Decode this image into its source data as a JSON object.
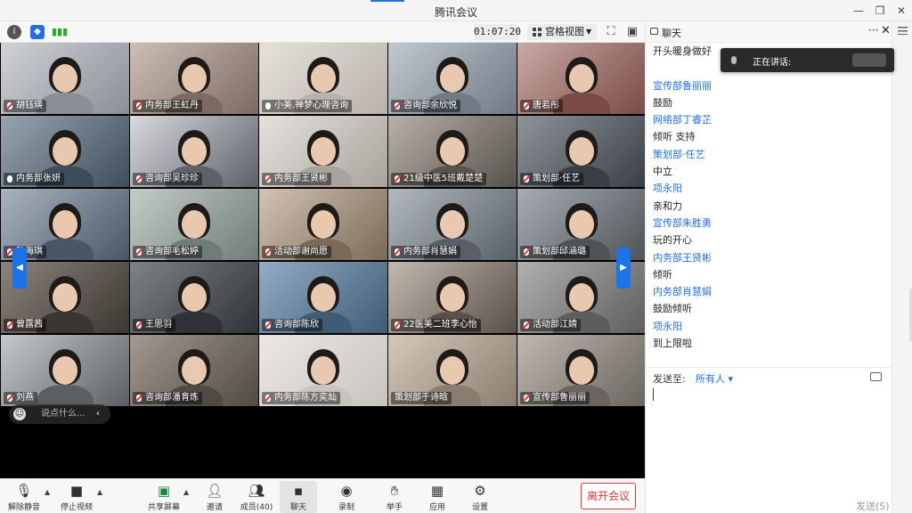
{
  "window": {
    "title": "腾讯会议"
  },
  "top_toolbar": {
    "timer": "01:07:20",
    "view_label": "宫格视图"
  },
  "participants": [
    {
      "name": "胡钰瑛",
      "mic": "muted"
    },
    {
      "name": "内务部王虹丹",
      "mic": "muted"
    },
    {
      "name": "小美.禅梦心理咨询",
      "mic": "on"
    },
    {
      "name": "咨询部余欣悦",
      "mic": "muted"
    },
    {
      "name": "唐若彤",
      "mic": "muted"
    },
    {
      "name": "内务部张妍",
      "mic": "on"
    },
    {
      "name": "咨询部吴珍珍",
      "mic": "muted"
    },
    {
      "name": "内务部王贤彬",
      "mic": "muted"
    },
    {
      "name": "21级中医5班戴楚楚",
      "mic": "muted"
    },
    {
      "name": "策划部·任艺",
      "mic": "muted"
    },
    {
      "name": "孙海琪",
      "mic": "muted"
    },
    {
      "name": "咨询部毛松婷",
      "mic": "muted"
    },
    {
      "name": "活动部谢尚愿",
      "mic": "muted"
    },
    {
      "name": "内务部肖慧娟",
      "mic": "muted"
    },
    {
      "name": "策划部邱涵璐",
      "mic": "muted"
    },
    {
      "name": "曾露茜",
      "mic": "muted"
    },
    {
      "name": "王思羽",
      "mic": "muted"
    },
    {
      "name": "咨询部陈欣",
      "mic": "muted"
    },
    {
      "name": "22医美二班李心怡",
      "mic": "muted"
    },
    {
      "name": "活动部江婧",
      "mic": "muted"
    },
    {
      "name": "刘燕",
      "mic": "muted"
    },
    {
      "name": "咨询部潘育炼",
      "mic": "muted"
    },
    {
      "name": "内务部陈方奕灿",
      "mic": "muted"
    },
    {
      "name": "策划部于诗晗",
      "mic": "none"
    },
    {
      "name": "宣传部鲁丽丽",
      "mic": "muted"
    }
  ],
  "quick_chat": {
    "placeholder": "说点什么..."
  },
  "bottom_toolbar": {
    "mute_label": "解除静音",
    "video_label": "停止视频",
    "share_label": "共享屏幕",
    "invite_label": "邀请",
    "members_label": "成员(40)",
    "chat_label": "聊天",
    "record_label": "录制",
    "raise_hand_label": "举手",
    "apps_label": "应用",
    "settings_label": "设置",
    "leave_label": "离开会议"
  },
  "chat": {
    "title": "聊天",
    "speaking_label": "正在讲话:",
    "messages": [
      {
        "type": "text",
        "text": "开头暖身做好"
      },
      {
        "type": "text",
        "text": ""
      },
      {
        "type": "sender",
        "text": "宣传部鲁丽丽"
      },
      {
        "type": "text",
        "text": "鼓励"
      },
      {
        "type": "sender",
        "text": "网络部丁睿芷"
      },
      {
        "type": "text",
        "text": "倾听 支持"
      },
      {
        "type": "sender",
        "text": "策划部·任艺"
      },
      {
        "type": "text",
        "text": "中立"
      },
      {
        "type": "sender",
        "text": "项永阳"
      },
      {
        "type": "text",
        "text": "亲和力"
      },
      {
        "type": "sender",
        "text": "宣传部朱胜勇"
      },
      {
        "type": "text",
        "text": "玩的开心"
      },
      {
        "type": "sender",
        "text": "内务部王贤彬"
      },
      {
        "type": "text",
        "text": "倾听"
      },
      {
        "type": "sender",
        "text": "内务部肖慧娟"
      },
      {
        "type": "text",
        "text": "鼓励倾听"
      },
      {
        "type": "sender",
        "text": "项永阳"
      },
      {
        "type": "text",
        "text": "到上限啦"
      }
    ],
    "send_to_label": "发送至:",
    "send_to_target": "所有人",
    "send_button": "发送(S)"
  }
}
